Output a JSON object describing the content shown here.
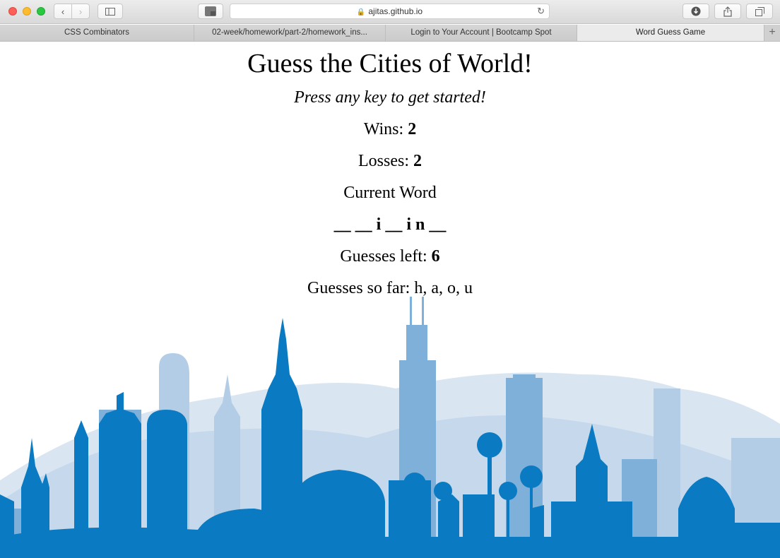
{
  "browser": {
    "address": "ajitas.github.io",
    "tabs": [
      {
        "label": "CSS Combinators"
      },
      {
        "label": "02-week/homework/part-2/homework_ins..."
      },
      {
        "label": "Login to Your Account | Bootcamp Spot"
      },
      {
        "label": "Word Guess Game"
      }
    ],
    "new_tab_label": "+"
  },
  "game": {
    "title": "Guess the Cities of World!",
    "subtitle": "Press any key to get started!",
    "wins_label": "Wins: ",
    "wins": "2",
    "losses_label": "Losses: ",
    "losses": "2",
    "current_word_label": "Current Word",
    "current_word": "__ __ i __ i n __",
    "guesses_left_label": "Guesses left: ",
    "guesses_left": "6",
    "guesses_so_far_label": "Guesses so far: ",
    "guesses_so_far": "h, a, o, u"
  },
  "colors": {
    "skyline_dark": "#0a7bc2",
    "skyline_mid": "#4b95cc",
    "skyline_light": "#9cc0e0",
    "skyline_pale": "#c9dcee"
  }
}
